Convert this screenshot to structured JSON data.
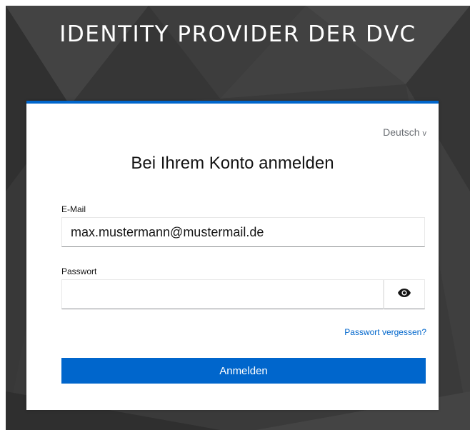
{
  "header": {
    "title": "IDENTITY PROVIDER DER DVC"
  },
  "login": {
    "language": "Deutsch",
    "language_chevron": "v",
    "title": "Bei Ihrem Konto anmelden",
    "email_label": "E-Mail",
    "email_value": "max.mustermann@mustermail.de",
    "password_label": "Passwort",
    "password_value": "",
    "show_password_icon": "eye-icon",
    "forgot_password": "Passwort vergessen?",
    "submit_label": "Anmelden"
  },
  "colors": {
    "accent": "#0066cc",
    "background": "#3a3a3a",
    "text": "#151515",
    "muted": "#6a6e73"
  }
}
